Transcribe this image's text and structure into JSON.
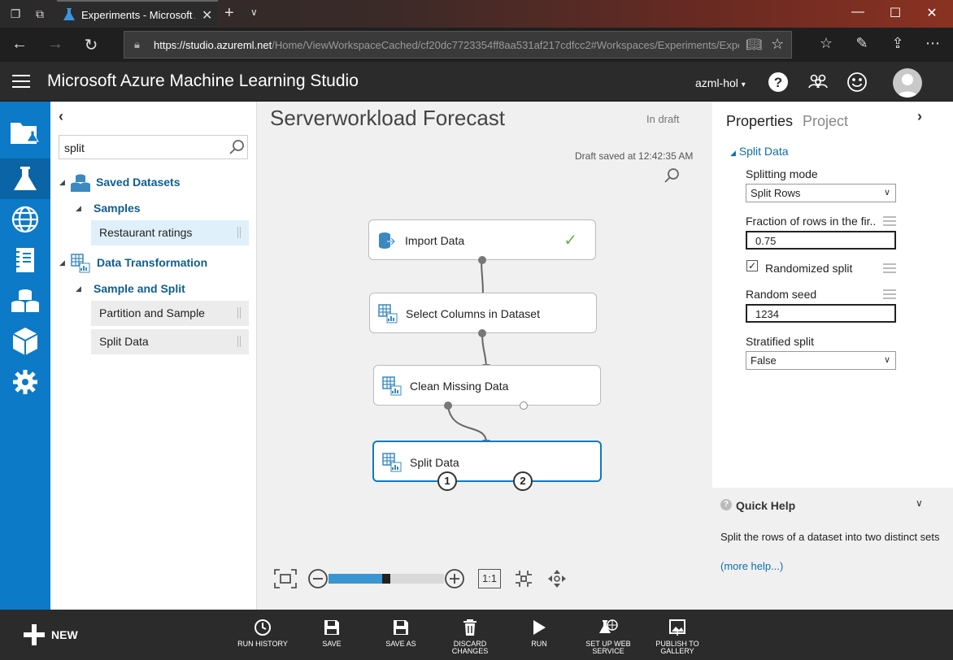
{
  "browser": {
    "tab_title": "Experiments - Microsoft Azure Machine Learning Studio",
    "url_host": "https://studio.azureml.net",
    "url_path": "/Home/ViewWorkspaceCached/cf20dc7723354ff8aa531af217cdfcc2#Workspaces/Experiments/Expe"
  },
  "app": {
    "title": "Microsoft Azure Machine Learning Studio",
    "workspace": "azml-hol"
  },
  "palette": {
    "search_value": "split",
    "tree": {
      "saved_datasets": "Saved Datasets",
      "samples": "Samples",
      "restaurant_ratings": "Restaurant ratings",
      "data_transformation": "Data Transformation",
      "sample_and_split": "Sample and Split",
      "partition_and_sample": "Partition and Sample",
      "split_data": "Split Data"
    }
  },
  "canvas": {
    "title": "Serverworkload Forecast",
    "status": "In draft",
    "saved": "Draft saved at 12:42:35 AM",
    "nodes": {
      "import_data": "Import Data",
      "select_columns": "Select Columns in Dataset",
      "clean_missing": "Clean Missing Data",
      "split_data": "Split Data"
    },
    "ports": {
      "out1": "1",
      "out2": "2"
    },
    "zoom_reset": "1:1",
    "zoom_level": 0.48
  },
  "properties": {
    "tab_properties": "Properties",
    "tab_project": "Project",
    "section": "Split Data",
    "splitting_mode_label": "Splitting mode",
    "splitting_mode_value": "Split Rows",
    "fraction_label": "Fraction of rows in the fir...",
    "fraction_value": "0.75",
    "randomized_label": "Randomized split",
    "randomized_checked": true,
    "seed_label": "Random seed",
    "seed_value": "1234",
    "stratified_label": "Stratified split",
    "stratified_value": "False"
  },
  "quick_help": {
    "title": "Quick Help",
    "text": "Split the rows of a dataset into two distinct sets",
    "link": "(more help...)"
  },
  "commands": {
    "new": "NEW",
    "run_history": "RUN HISTORY",
    "save": "SAVE",
    "save_as": "SAVE AS",
    "discard": "DISCARD CHANGES",
    "run": "RUN",
    "web_service": "SET UP WEB\nSERVICE",
    "publish": "PUBLISH TO\nGALLERY"
  },
  "colors": {
    "nav_blue": "#0c7ac7",
    "header_dark": "#2b2b2b",
    "link_blue": "#0f6fa8",
    "check_green": "#6ab04c"
  }
}
